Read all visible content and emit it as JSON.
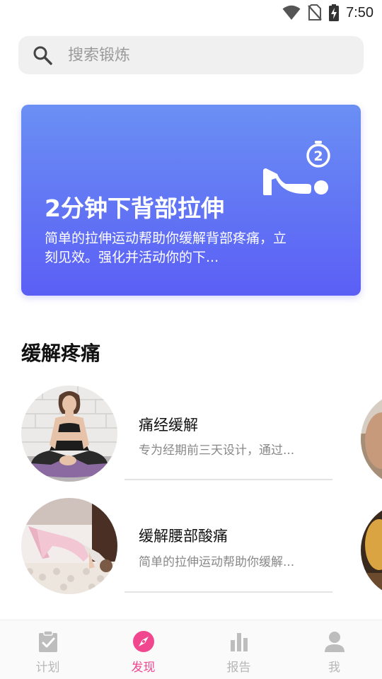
{
  "status_bar": {
    "time": "7:50",
    "icons": [
      "wifi-icon",
      "no-sim-icon",
      "battery-charging-icon"
    ]
  },
  "search": {
    "placeholder": "搜索锻炼",
    "value": "",
    "icon": "search-icon"
  },
  "banner": {
    "title": "2分钟下背部拉伸",
    "description": "简单的拉伸运动帮助你缓解背部疼痛，立刻见效。强化并活动你的下...",
    "icon": "stopwatch-2-icon",
    "gradient_top": "#6a8ff4",
    "gradient_bottom": "#5b5ff5"
  },
  "section": {
    "title": "缓解疼痛",
    "items": [
      {
        "title": "痛经缓解",
        "description": "专为经期前三天设计，通过..."
      },
      {
        "title": "缓解腰部酸痛",
        "description": "简单的拉伸运动帮助你缓解..."
      }
    ]
  },
  "bottom_nav": {
    "items": [
      {
        "label": "计划",
        "icon": "clipboard-check-icon",
        "active": false
      },
      {
        "label": "发现",
        "icon": "compass-icon",
        "active": true
      },
      {
        "label": "报告",
        "icon": "bar-chart-icon",
        "active": false
      },
      {
        "label": "我",
        "icon": "person-icon",
        "active": false
      }
    ],
    "active_color": "#f0478f",
    "inactive_color": "#b7b7b7"
  }
}
